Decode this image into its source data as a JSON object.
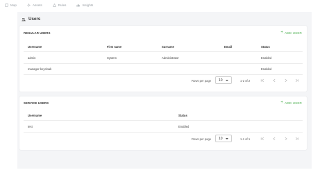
{
  "nav": {
    "items": [
      {
        "label": "Map",
        "icon": "map-icon"
      },
      {
        "label": "Assets",
        "icon": "assets-icon"
      },
      {
        "label": "Rules",
        "icon": "rules-icon"
      },
      {
        "label": "Insights",
        "icon": "insights-icon"
      }
    ]
  },
  "page": {
    "title": "Users",
    "icon": "users-icon"
  },
  "regular": {
    "title": "REGULAR USERS",
    "add_label": "ADD USER",
    "columns": [
      "Username",
      "First name",
      "Surname",
      "Email",
      "Status"
    ],
    "rows": [
      {
        "username": "admin",
        "first_name": "System",
        "surname": "Administrator",
        "email": "",
        "status": "Enabled"
      },
      {
        "username": "manager-keycloak",
        "first_name": "",
        "surname": "",
        "email": "",
        "status": "Enabled"
      }
    ],
    "pager": {
      "rows_per_page_label": "Rows per page",
      "rows_per_page": "10",
      "range": "1-2 of 2"
    }
  },
  "service": {
    "title": "SERVICE USERS",
    "add_label": "ADD USER",
    "columns": [
      "Username",
      "Status"
    ],
    "rows": [
      {
        "username": "test",
        "status": "Enabled"
      }
    ],
    "pager": {
      "rows_per_page_label": "Rows per page",
      "rows_per_page": "10",
      "range": "1-1 of 1"
    }
  },
  "colors": {
    "accent": "#4caf50",
    "nav_text": "#9aa0a6",
    "background": "#f4f5f7"
  }
}
